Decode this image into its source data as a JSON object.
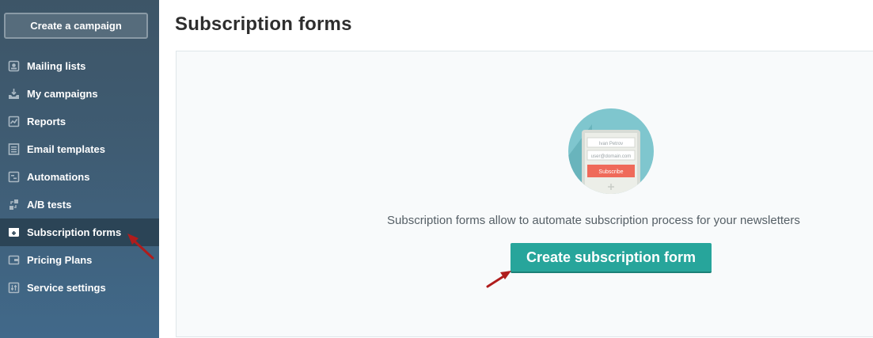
{
  "sidebar": {
    "create_button": "Create a campaign",
    "items": [
      {
        "label": "Mailing lists",
        "icon": "mailing-lists-icon"
      },
      {
        "label": "My campaigns",
        "icon": "campaigns-icon"
      },
      {
        "label": "Reports",
        "icon": "reports-icon"
      },
      {
        "label": "Email templates",
        "icon": "templates-icon"
      },
      {
        "label": "Automations",
        "icon": "automations-icon"
      },
      {
        "label": "A/B tests",
        "icon": "ab-tests-icon"
      },
      {
        "label": "Subscription forms",
        "icon": "subscription-forms-icon",
        "active": true
      },
      {
        "label": "Pricing Plans",
        "icon": "pricing-icon"
      },
      {
        "label": "Service settings",
        "icon": "settings-icon"
      }
    ]
  },
  "main": {
    "title": "Subscription forms",
    "illustration": {
      "name_placeholder": "Ivan Petrov",
      "email_placeholder": "user@domain.com",
      "button_label": "Subscribe"
    },
    "description": "Subscription forms allow to automate subscription process for your newsletters",
    "cta_label": "Create subscription form"
  },
  "colors": {
    "sidebar_bg": "#3f5c73",
    "active_bg": "#2b4456",
    "cta_bg": "#27a59b",
    "annotation_arrow": "#b01c1c",
    "subscribe_button": "#ef6a5a"
  }
}
